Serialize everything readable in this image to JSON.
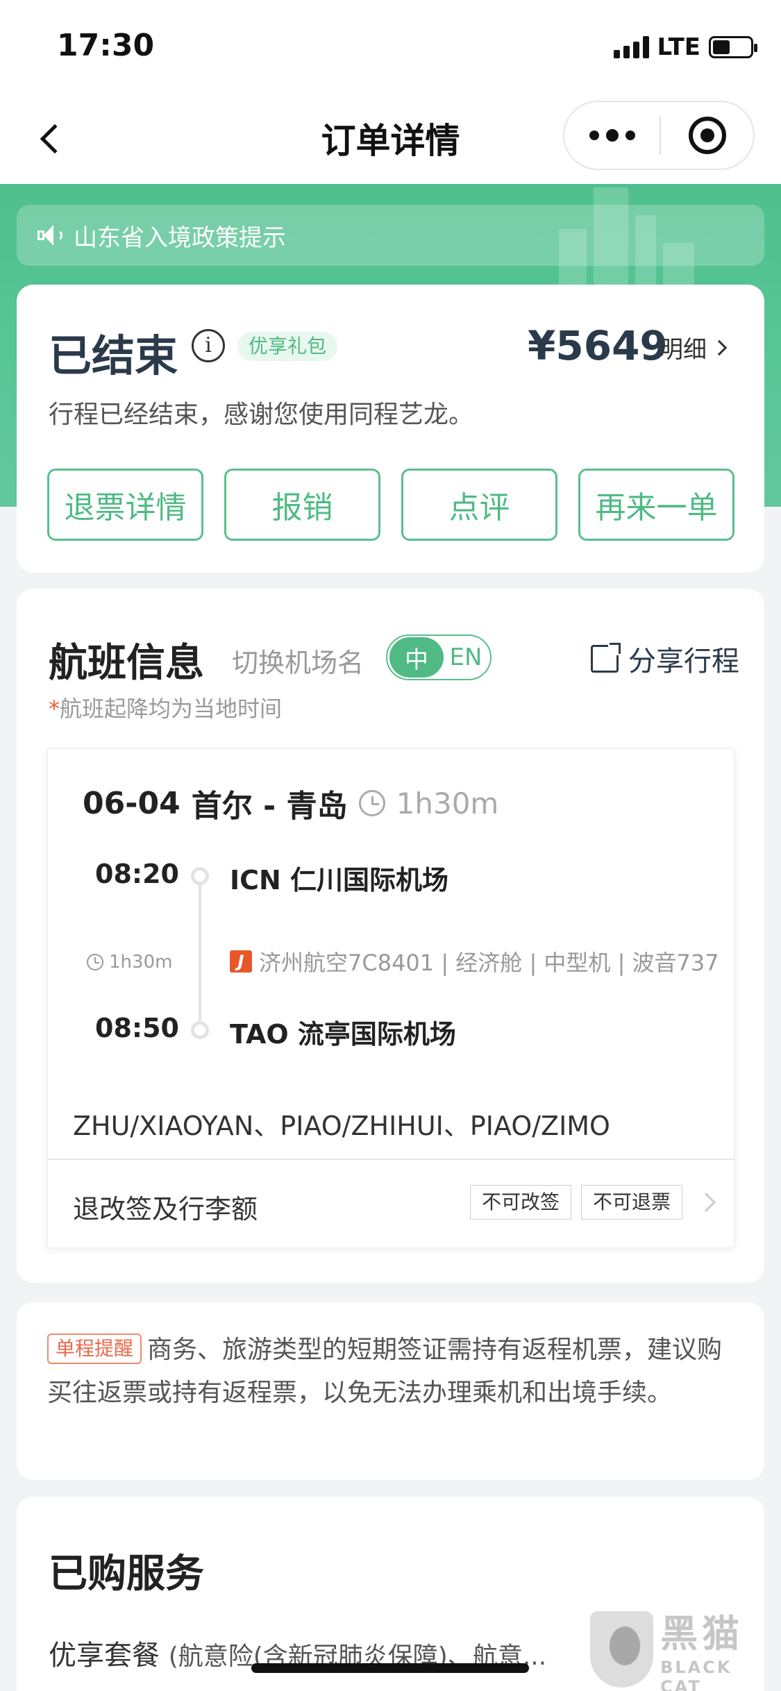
{
  "status_bar": {
    "time": "17:30",
    "network": "LTE"
  },
  "nav": {
    "title": "订单详情"
  },
  "notice": {
    "text": "山东省入境政策提示"
  },
  "order": {
    "status": "已结束",
    "package_badge": "优享礼包",
    "price": "¥5649",
    "detail_label": "明细",
    "description": "行程已经结束，感谢您使用同程艺龙。",
    "actions": [
      "退票详情",
      "报销",
      "点评",
      "再来一单"
    ]
  },
  "flight_info": {
    "title": "航班信息",
    "switch_label": "切换机场名",
    "lang_on": "中",
    "lang_off": "EN",
    "share_label": "分享行程",
    "note_star": "*",
    "note": "航班起降均为当地时间",
    "segment": {
      "date": "06-04",
      "route": "首尔 - 青岛",
      "duration": "1h30m",
      "departure_time": "08:20",
      "departure_airport": "ICN 仁川国际机场",
      "mid_duration": "1h30m",
      "airline_logo_letter": "J",
      "flight_meta": "济州航空7C8401 | 经济舱 | 中型机 | 波音737",
      "arrival_time": "08:50",
      "arrival_airport": "TAO 流亭国际机场"
    },
    "passengers": "ZHU/XIAOYAN、PIAO/ZHIHUI、PIAO/ZIMO",
    "rules_label": "退改签及行李额",
    "rule_tags": [
      "不可改签",
      "不可退票"
    ]
  },
  "reminder": {
    "tag": "单程提醒",
    "text": "商务、旅游类型的短期签证需持有返程机票，建议购买往返票或持有返程票，以免无法办理乘机和出境手续。"
  },
  "services": {
    "title": "已购服务",
    "item_label": "优享套餐",
    "item_detail": "(航意险(含新冠肺炎保障)、航意..."
  },
  "watermark": {
    "cn": "黑猫",
    "en": "BLACK CAT"
  },
  "colors": {
    "brand_green": "#4fba84",
    "reminder_red": "#ec6a4a",
    "title_dark": "#2b3a4a"
  },
  "icons": [
    "back-chevron-icon",
    "more-dots-icon",
    "target-icon",
    "speaker-icon",
    "info-icon",
    "chevron-right-icon",
    "share-icon",
    "clock-icon",
    "airline-logo-icon"
  ]
}
